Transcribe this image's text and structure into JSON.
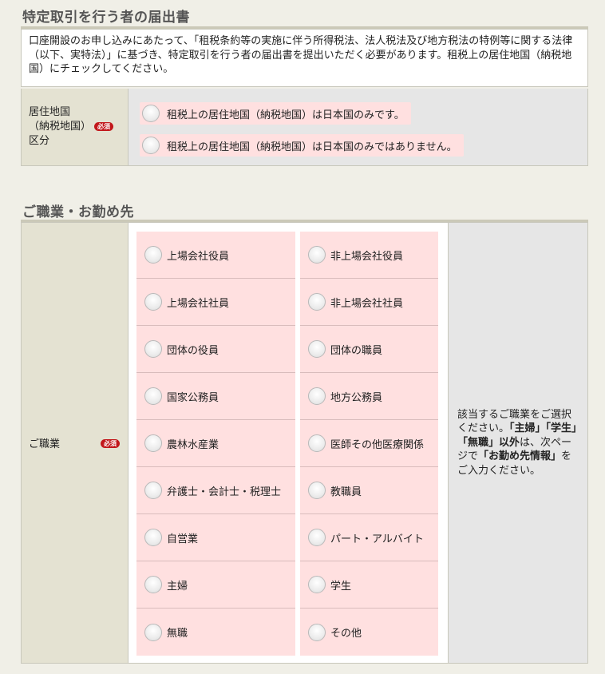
{
  "section1": {
    "title": "特定取引を行う者の届出書",
    "intro": "口座開設のお申し込みにあたって、「租税条約等の実施に伴う所得税法、法人税法及び地方税法の特例等に関する法律（以下、実特法）」に基づき、特定取引を行う者の届出書を提出いただく必要があります。租税上の居住地国（納税地国）にチェックしてください。",
    "label_line1": "居住地国",
    "label_line2": "（納税地国）",
    "label_line3": "区分",
    "required": "必須",
    "options": [
      "租税上の居住地国（納税地国）は日本国のみです。",
      "租税上の居住地国（納税地国）は日本国のみではありません。"
    ]
  },
  "section2": {
    "title": "ご職業・お勤め先",
    "label": "ご職業",
    "required": "必須",
    "occupations": [
      "上場会社役員",
      "非上場会社役員",
      "上場会社社員",
      "非上場会社社員",
      "団体の役員",
      "団体の職員",
      "国家公務員",
      "地方公務員",
      "農林水産業",
      "医師その他医療関係",
      "弁護士・会計士・税理士",
      "教職員",
      "自営業",
      "パート・アルバイト",
      "主婦",
      "学生",
      "無職",
      "その他"
    ],
    "note": {
      "p1": "該当するご職業をご選択ください。",
      "b1": "「主婦」「学生」「無職」以外",
      "p2": "は、次ページで",
      "b2": "「お勤め先情報」",
      "p3": "をご入力ください。"
    }
  }
}
